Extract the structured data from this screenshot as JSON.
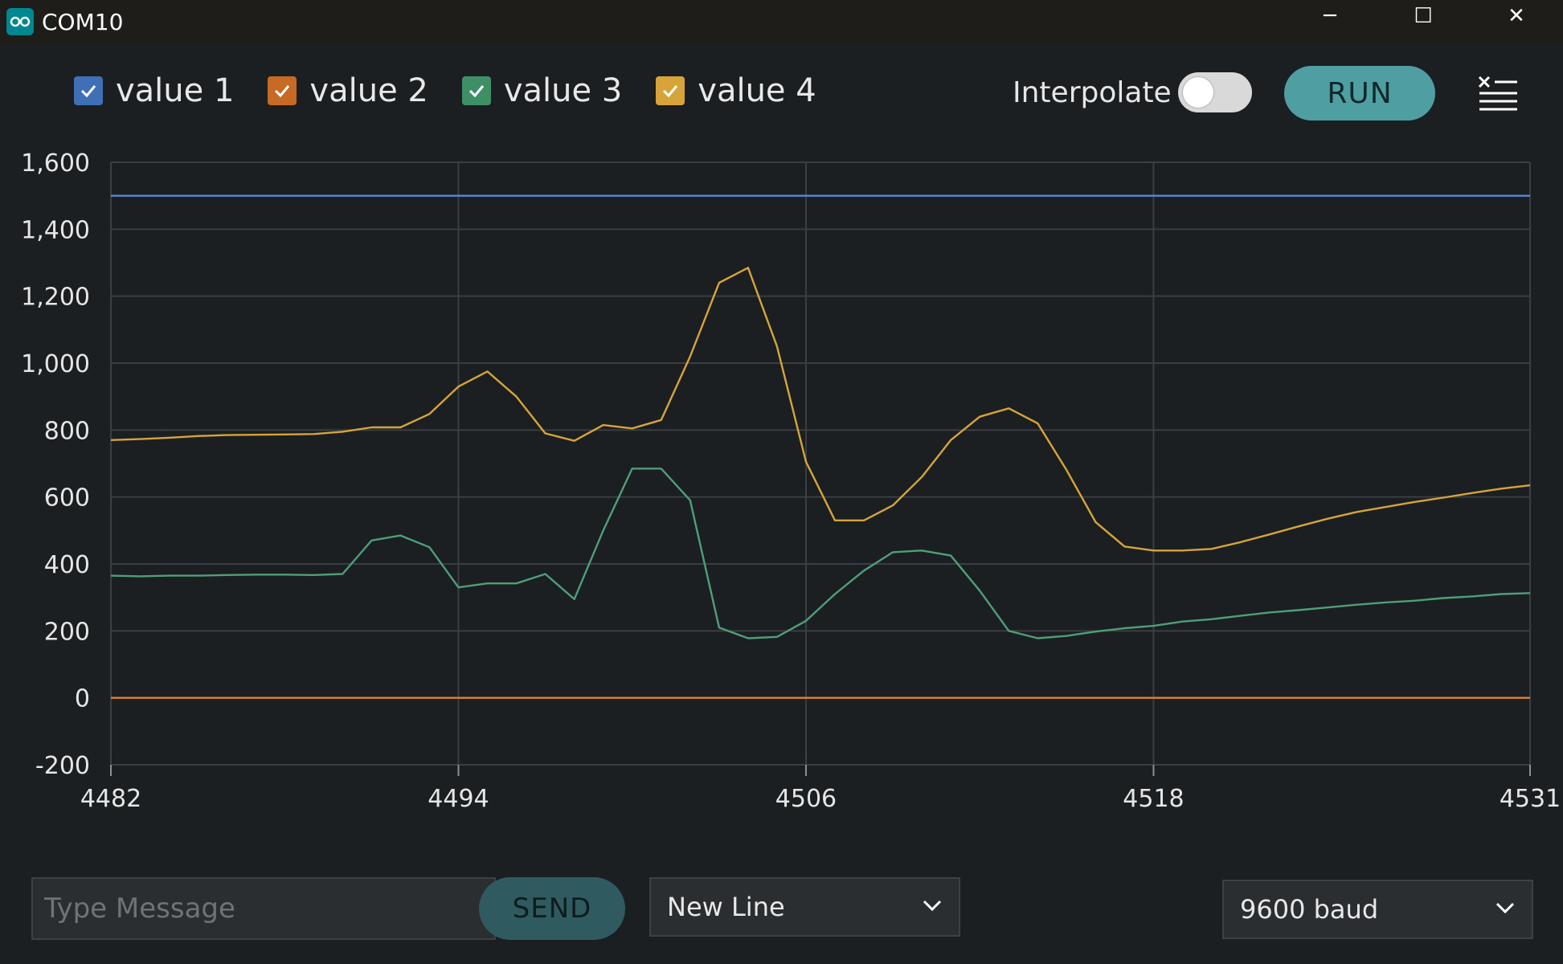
{
  "window": {
    "title": "COM10",
    "minimize_glyph": "─",
    "maximize_glyph": "☐",
    "close_glyph": "✕"
  },
  "legend": [
    {
      "label": "value 1",
      "color": "#3f6fb5"
    },
    {
      "label": "value 2",
      "color": "#c66a26"
    },
    {
      "label": "value 3",
      "color": "#3f8f66"
    },
    {
      "label": "value 4",
      "color": "#d7a43a"
    }
  ],
  "controls": {
    "interpolate_label": "Interpolate",
    "interpolate_on": false,
    "run_label": "RUN"
  },
  "chart_data": {
    "type": "line",
    "grid": true,
    "xlim": [
      4482,
      4531
    ],
    "ylim": [
      -200,
      1600
    ],
    "xticks": [
      4482,
      4494,
      4506,
      4518,
      4531
    ],
    "xtick_labels": [
      "4482",
      "4494",
      "4506",
      "4518",
      "4531"
    ],
    "yticks": [
      -200,
      0,
      200,
      400,
      600,
      800,
      1000,
      1200,
      1400,
      1600
    ],
    "ytick_labels": [
      "-200",
      "0",
      "200",
      "400",
      "600",
      "800",
      "1,000",
      "1,200",
      "1,400",
      "1,600"
    ],
    "x": [
      4482,
      4483,
      4484,
      4485,
      4486,
      4487,
      4488,
      4489,
      4490,
      4491,
      4492,
      4493,
      4494,
      4495,
      4496,
      4497,
      4498,
      4499,
      4500,
      4501,
      4502,
      4503,
      4504,
      4505,
      4506,
      4507,
      4508,
      4509,
      4510,
      4511,
      4512,
      4513,
      4514,
      4515,
      4516,
      4517,
      4518,
      4519,
      4520,
      4521,
      4522,
      4523,
      4524,
      4525,
      4526,
      4527,
      4528,
      4529,
      4530,
      4531
    ],
    "series": [
      {
        "name": "value 1",
        "color": "#5b86d1",
        "values": [
          1500,
          1500,
          1500,
          1500,
          1500,
          1500,
          1500,
          1500,
          1500,
          1500,
          1500,
          1500,
          1500,
          1500,
          1500,
          1500,
          1500,
          1500,
          1500,
          1500,
          1500,
          1500,
          1500,
          1500,
          1500,
          1500,
          1500,
          1500,
          1500,
          1500,
          1500,
          1500,
          1500,
          1500,
          1500,
          1500,
          1500,
          1500,
          1500,
          1500,
          1500,
          1500,
          1500,
          1500,
          1500,
          1500,
          1500,
          1500,
          1500,
          1500
        ]
      },
      {
        "name": "value 2",
        "color": "#e0812f",
        "values": [
          0,
          0,
          0,
          0,
          0,
          0,
          0,
          0,
          0,
          0,
          0,
          0,
          0,
          0,
          0,
          0,
          0,
          0,
          0,
          0,
          0,
          0,
          0,
          0,
          0,
          0,
          0,
          0,
          0,
          0,
          0,
          0,
          0,
          0,
          0,
          0,
          0,
          0,
          0,
          0,
          0,
          0,
          0,
          0,
          0,
          0,
          0,
          0,
          0,
          0
        ]
      },
      {
        "name": "value 3",
        "color": "#4f9e78",
        "values": [
          365,
          363,
          365,
          365,
          367,
          368,
          368,
          367,
          370,
          470,
          485,
          450,
          330,
          342,
          342,
          370,
          295,
          500,
          685,
          685,
          590,
          210,
          178,
          182,
          230,
          310,
          380,
          435,
          440,
          425,
          320,
          200,
          178,
          185,
          198,
          208,
          215,
          228,
          235,
          245,
          255,
          262,
          270,
          278,
          285,
          290,
          298,
          303,
          310,
          313
        ]
      },
      {
        "name": "value 4",
        "color": "#d7a43a",
        "values": [
          770,
          773,
          777,
          782,
          785,
          786,
          787,
          788,
          795,
          808,
          808,
          848,
          930,
          975,
          900,
          790,
          768,
          815,
          805,
          830,
          1020,
          1240,
          1285,
          1050,
          705,
          530,
          530,
          575,
          660,
          770,
          840,
          865,
          820,
          680,
          525,
          452,
          440,
          440,
          445,
          465,
          488,
          512,
          535,
          555,
          570,
          585,
          598,
          612,
          625,
          635
        ]
      }
    ]
  },
  "footer": {
    "message_placeholder": "Type Message",
    "send_label": "SEND",
    "line_ending": "New Line",
    "baud": "9600 baud"
  }
}
